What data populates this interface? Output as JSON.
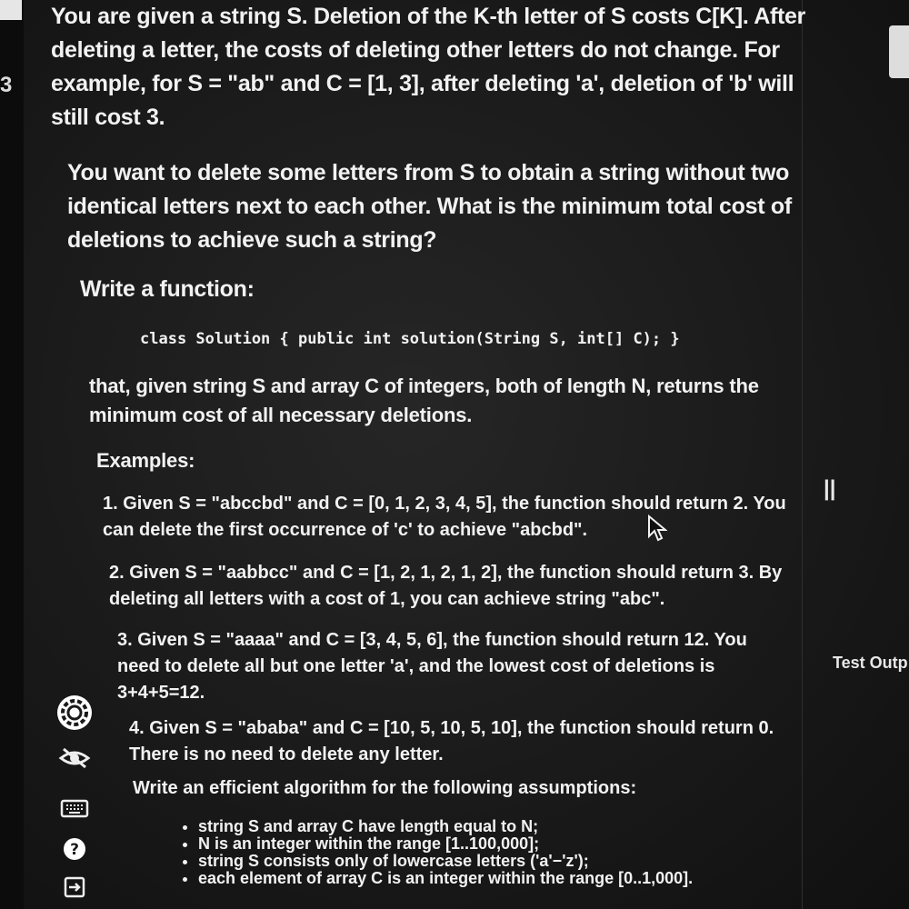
{
  "problem": {
    "p1": "You are given a string S. Deletion of the K-th letter of S costs C[K]. After deleting a letter, the costs of deleting other letters do not change. For example, for S = \"ab\" and C = [1, 3], after deleting 'a', deletion of 'b' will still cost 3.",
    "p2": "You want to delete some letters from S to obtain a string without two identical letters next to each other. What is the minimum total cost of deletions to achieve such a string?",
    "write_fn": "Write a function:",
    "code": "class Solution { public int solution(String S, int[] C); }",
    "p3": "that, given string S and array C of integers, both of length N, returns the minimum cost of all necessary deletions.",
    "examples_heading": "Examples:",
    "examples": [
      "1. Given S = \"abccbd\" and C = [0, 1, 2, 3, 4, 5], the function should return 2. You can delete the first occurrence of 'c' to achieve \"abcbd\".",
      "2. Given S = \"aabbcc\" and C = [1, 2, 1, 2, 1, 2], the function should return 3. By deleting all letters with a cost of 1, you can achieve string \"abc\".",
      "3. Given S = \"aaaa\" and C = [3, 4, 5, 6], the function should return 12. You need to delete all but one letter 'a', and the lowest cost of deletions is 3+4+5=12.",
      "4. Given S = \"ababa\" and C = [10, 5, 10, 5, 10], the function should return 0. There is no need to delete any letter."
    ],
    "assumptions_heading": "Write an efficient algorithm for the following assumptions:",
    "assumptions": [
      "string S and array C have length equal to N;",
      "N is an integer within the range [1..100,000];",
      "string S consists only of lowercase letters ('a'−'z');",
      "each element of array C is an integer within the range [0..1,000]."
    ]
  },
  "side": {
    "pause_glyph": "||",
    "test_output_label": "Test Outp",
    "left_mark": "3"
  },
  "icons": {
    "settings": "gear-icon",
    "visibility": "eye-off-icon",
    "keyboard": "keyboard-icon",
    "help": "help-icon",
    "exit": "exit-icon"
  }
}
